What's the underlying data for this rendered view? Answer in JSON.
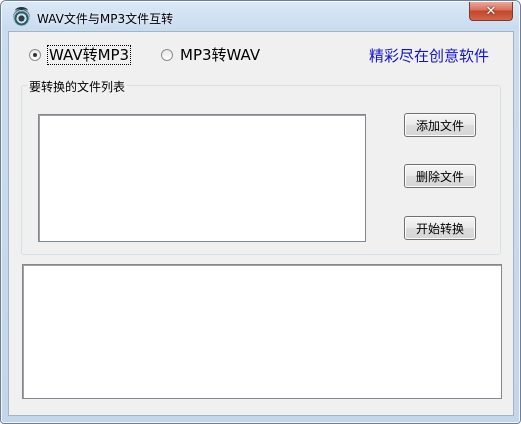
{
  "window": {
    "title": "WAV文件与MP3文件互转",
    "close_label": "✕"
  },
  "mode": {
    "options": [
      {
        "label": "WAV转MP3",
        "checked": true
      },
      {
        "label": "MP3转WAV",
        "checked": false
      }
    ]
  },
  "slogan": "精彩尽在创意软件",
  "file_group": {
    "legend": "要转换的文件列表"
  },
  "buttons": {
    "add": "添加文件",
    "remove": "删除文件",
    "start": "开始转换"
  },
  "colors": {
    "slogan": "#1414c8",
    "close_button": "#c4452b"
  }
}
